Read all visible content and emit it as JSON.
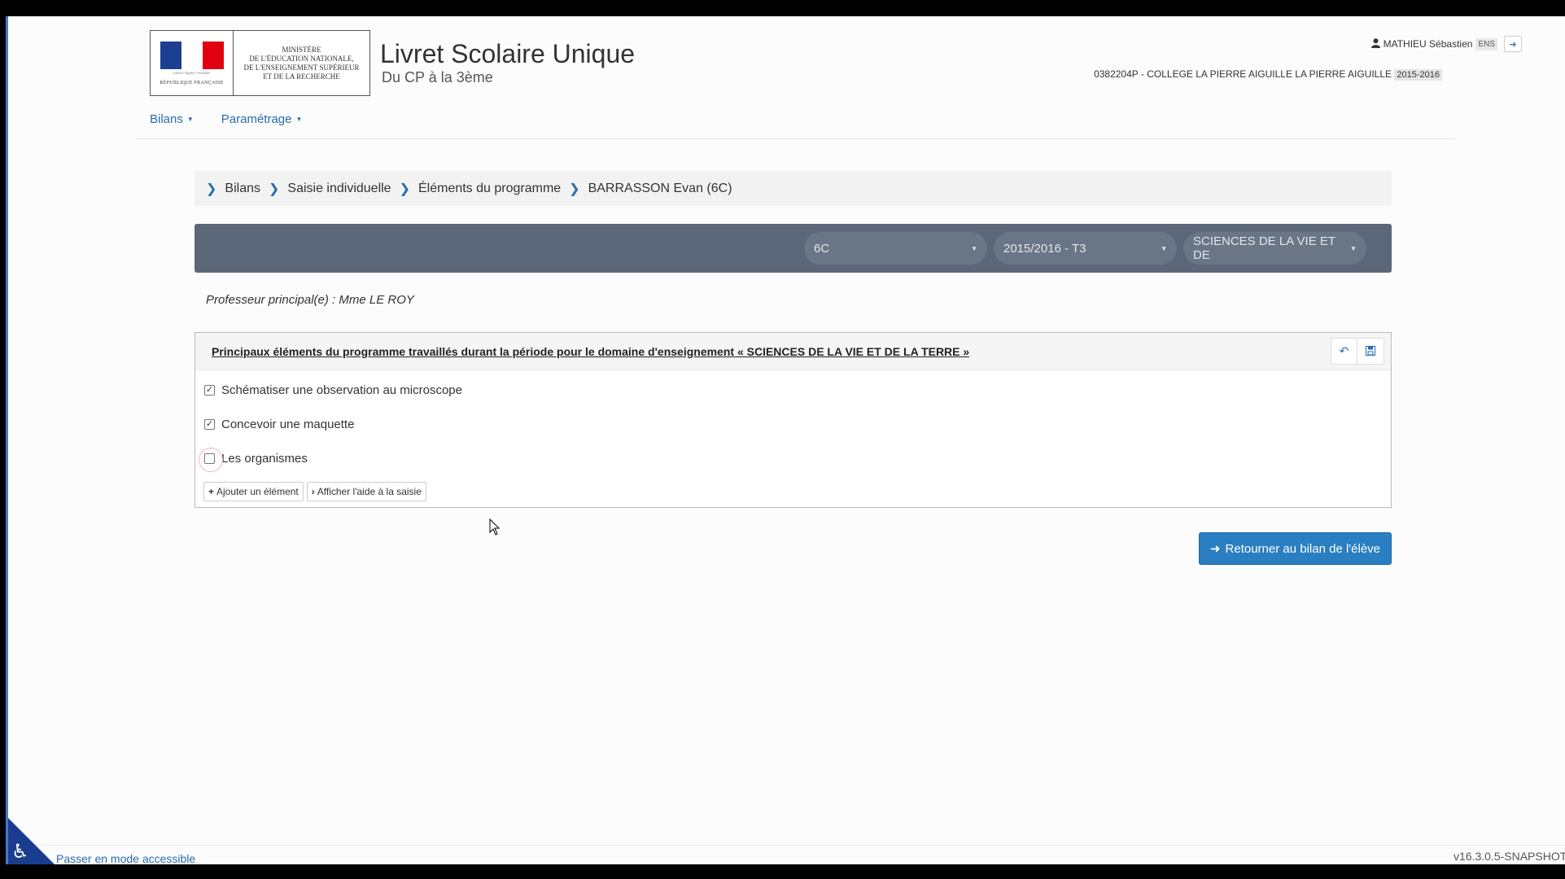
{
  "header": {
    "ministry_text": "MINISTÈRE\nDE L'ÉDUCATION NATIONALE,\nDE L'ENSEIGNEMENT SUPÉRIEUR\nET DE LA RECHERCHE",
    "republic_text": "RÉPUBLIQUE FRANÇAISE",
    "republic_motto": "Liberté • Égalité • Fraternité",
    "app_title": "Livret Scolaire Unique",
    "app_subtitle": "Du CP à la 3ème",
    "user_name": "MATHIEU Sébastien",
    "user_role": "ENS",
    "school": "0382204P - COLLEGE LA PIERRE AIGUILLE LA PIERRE AIGUILLE",
    "school_year": "2015-2016"
  },
  "nav": {
    "items": [
      {
        "label": "Bilans"
      },
      {
        "label": "Paramétrage"
      }
    ]
  },
  "breadcrumb": [
    "Bilans",
    "Saisie individuelle",
    "Éléments du programme",
    "BARRASSON Evan (6C)"
  ],
  "toolbar": {
    "class_select": "6C",
    "period_select": "2015/2016 - T3",
    "subject_select": "SCIENCES DE LA VIE ET DE"
  },
  "prof_principal": "Professeur principal(e) : Mme LE ROY",
  "panel": {
    "title": "Principaux éléments du programme travaillés durant la période pour le domaine d'enseignement « SCIENCES DE LA VIE ET DE LA TERRE »",
    "items": [
      {
        "label": "Schématiser une observation au microscope",
        "checked": true
      },
      {
        "label": "Concevoir une maquette",
        "checked": true
      },
      {
        "label": "Les organismes",
        "checked": false
      }
    ],
    "add_button": "Ajouter un élément",
    "help_button": "Afficher l'aide à la saisie"
  },
  "back_button": "Retourner au bilan de l'élève",
  "footer": {
    "accessible_link": "Passer en mode accessible",
    "version": "v16.3.0.5-SNAPSHOT"
  },
  "colors": {
    "accent": "#2a7ec2",
    "toolbar": "#5b6779",
    "link": "#2a6bb0"
  }
}
